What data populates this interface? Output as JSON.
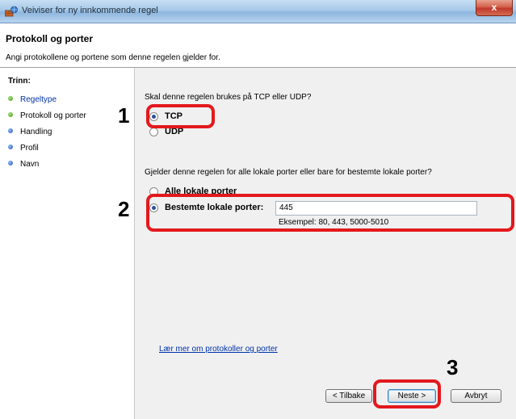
{
  "window": {
    "title": "Veiviser for ny innkommende regel",
    "close_label": "x"
  },
  "header": {
    "title": "Protokoll og porter",
    "description": "Angi protokollene og portene som denne regelen gjelder for."
  },
  "steps": {
    "label": "Trinn:",
    "items": [
      {
        "label": "Regeltype",
        "state": "completed-link"
      },
      {
        "label": "Protokoll og porter",
        "state": "current"
      },
      {
        "label": "Handling",
        "state": "pending"
      },
      {
        "label": "Profil",
        "state": "pending"
      },
      {
        "label": "Navn",
        "state": "pending"
      }
    ]
  },
  "protocol": {
    "question": "Skal denne regelen brukes på TCP eller UDP?",
    "options": [
      {
        "label": "TCP",
        "checked": true
      },
      {
        "label": "UDP",
        "checked": false
      }
    ]
  },
  "ports": {
    "question": "Gjelder denne regelen for alle lokale porter eller bare for bestemte lokale porter?",
    "all_label": "Alle lokale porter",
    "specific_label": "Bestemte lokale porter:",
    "specific_checked": true,
    "value": "445",
    "example": "Eksempel: 80, 443, 5000-5010"
  },
  "learn_more": "Lær mer om protokoller og porter",
  "buttons": {
    "back": "< Tilbake",
    "next": "Neste >",
    "cancel": "Avbryt"
  },
  "annotations": [
    "1",
    "2",
    "3"
  ],
  "colors": {
    "callout": "#e3191c",
    "link": "#0033aa",
    "step_done": "#3f9a1f",
    "step_pending": "#2a5cb8"
  }
}
